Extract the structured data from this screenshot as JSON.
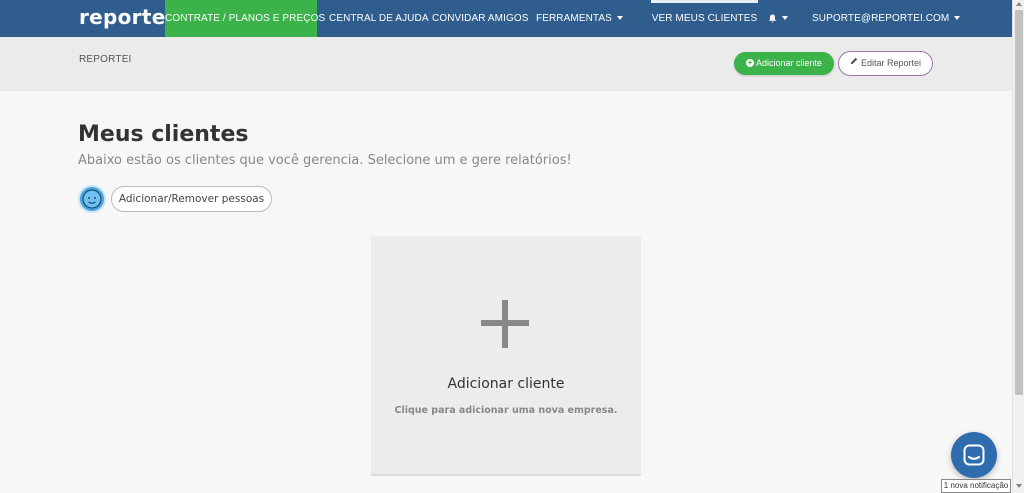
{
  "nav": {
    "logo": "reportei",
    "plans": "CONTRATE / PLANOS E PREÇOS",
    "help": "CENTRAL DE AJUDA",
    "invite": "CONVIDAR AMIGOS",
    "tools": "FERRAMENTAS",
    "clients": "VER MEUS CLIENTES",
    "user": "SUPORTE@REPORTEI.COM"
  },
  "subheader": {
    "breadcrumb": "REPORTEI",
    "add_client": "Adicionar cliente",
    "edit": "Editar Reportei"
  },
  "main": {
    "title": "Meus clientes",
    "subtitle": "Abaixo estão os clientes que você gerencia. Selecione um e gere relatórios!",
    "people_button": "Adicionar/Remover pessoas"
  },
  "card": {
    "title": "Adicionar cliente",
    "description": "Clique para adicionar uma nova empresa."
  },
  "notification": "1 nova notificação",
  "colors": {
    "nav_bg": "#2e5d8e",
    "accent_green": "#3bb34a",
    "edit_border": "#9b74b6",
    "chat_bg": "#2f6cae"
  }
}
